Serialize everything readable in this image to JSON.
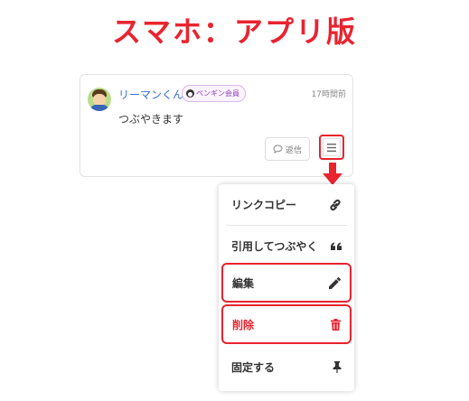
{
  "page_heading": "スマホ：アプリ版",
  "post": {
    "username": "リーマンくん",
    "badge": "ペンギン会員",
    "time": "17時間前",
    "body": "つぶやきます",
    "reply_label": "返信"
  },
  "menu": {
    "items": [
      {
        "label": "リンクコピー",
        "icon": "link-icon"
      },
      {
        "label": "引用してつぶやく",
        "icon": "quote-icon"
      },
      {
        "label": "編集",
        "icon": "pencil-icon"
      },
      {
        "label": "削除",
        "icon": "trash-icon"
      },
      {
        "label": "固定する",
        "icon": "pin-icon"
      }
    ]
  },
  "colors": {
    "accent_red": "#e8242f",
    "username_blue": "#3b6fd6",
    "badge_purple": "#8b3fb3"
  }
}
